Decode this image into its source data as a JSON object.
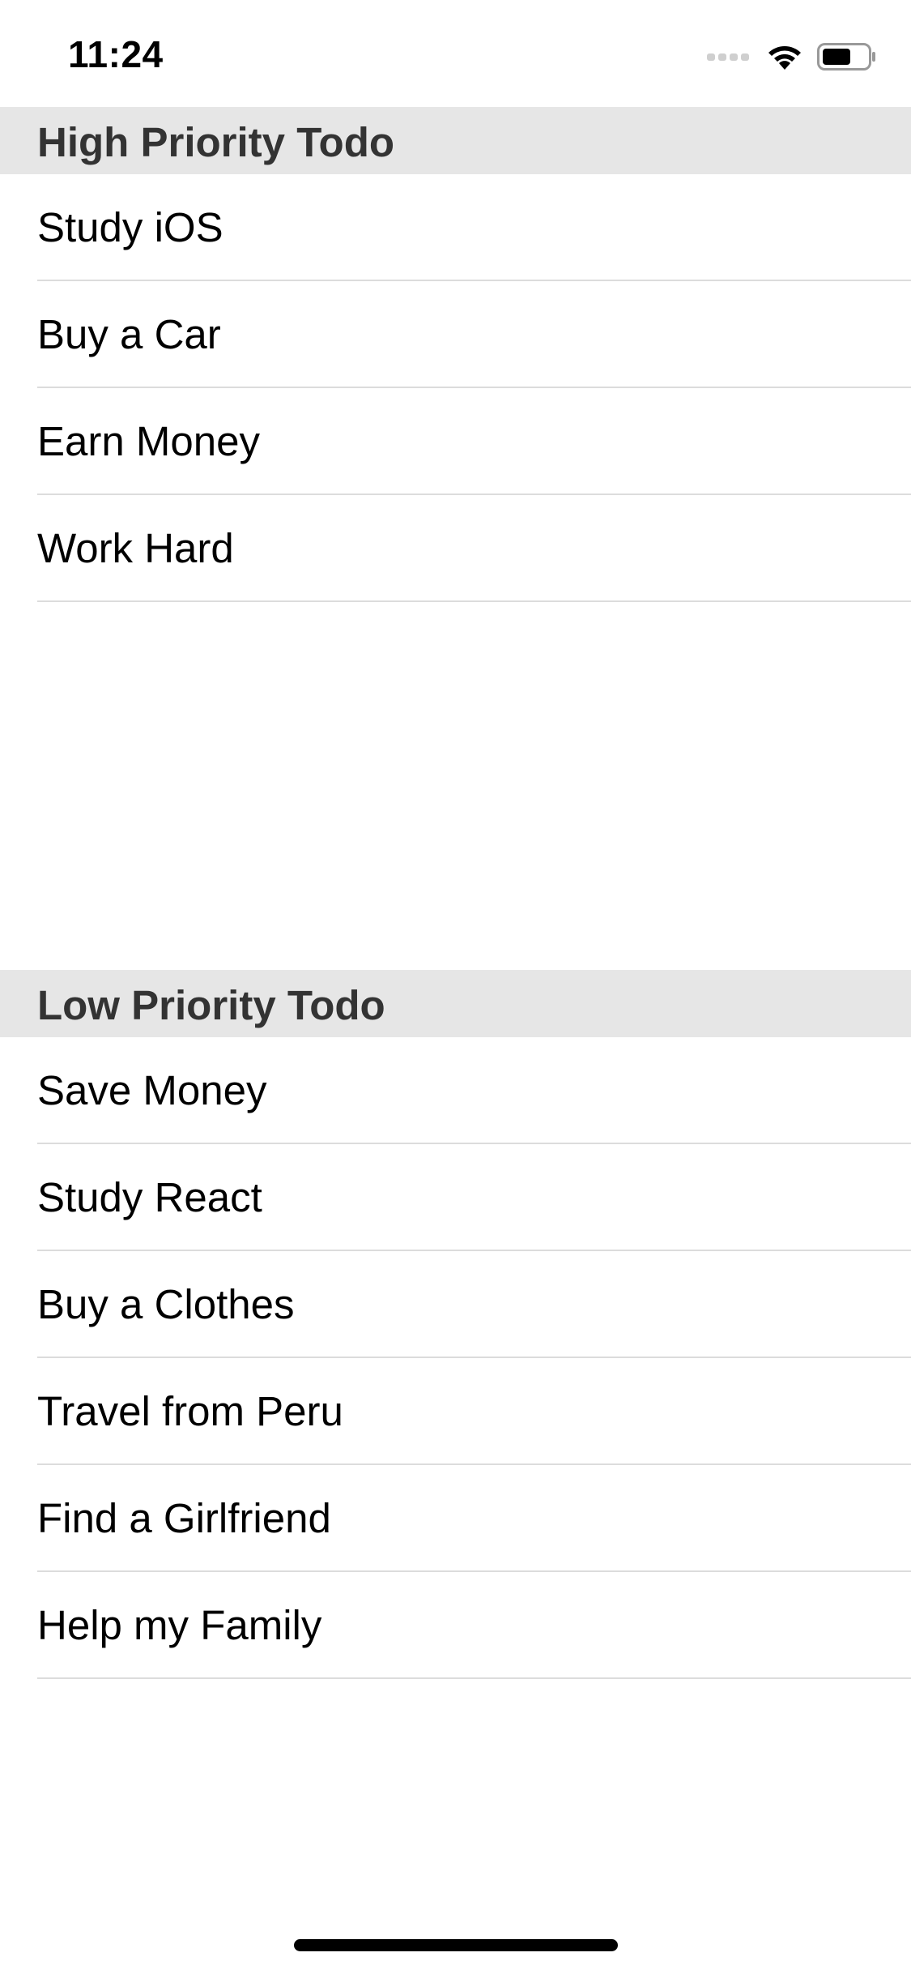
{
  "status_bar": {
    "time": "11:24",
    "icons": [
      "cellular-signal-icon",
      "wifi-icon",
      "battery-icon"
    ]
  },
  "sections": [
    {
      "title": "High Priority Todo",
      "items": [
        "Study iOS",
        "Buy a Car",
        "Earn Money",
        "Work Hard"
      ]
    },
    {
      "title": "Low Priority Todo",
      "items": [
        "Save Money",
        "Study React",
        "Buy a Clothes",
        "Travel from Peru",
        "Find a Girlfriend",
        "Help my Family"
      ]
    }
  ],
  "colors": {
    "section_header_bg": "#e6e6e6",
    "section_header_text": "#333333",
    "separator": "#dcdcdc",
    "background": "#ffffff"
  }
}
